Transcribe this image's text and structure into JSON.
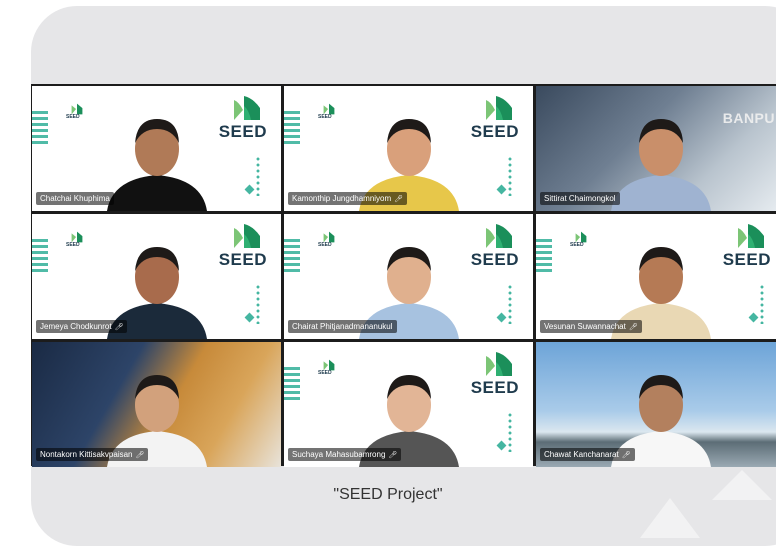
{
  "caption": "\"SEED Project\"",
  "logo_text": "SEED",
  "banner_text": "BANPU",
  "participants": [
    {
      "name": "Chatchai Khuphima",
      "bg": "seed",
      "muted": false
    },
    {
      "name": "Kamonthip Jungdhamniyom",
      "bg": "seed",
      "muted": true
    },
    {
      "name": "Sittirat Chaimongkol",
      "bg": "office",
      "muted": false
    },
    {
      "name": "Jemeya Chodkunrot",
      "bg": "seed",
      "muted": true
    },
    {
      "name": "Chairat Phitjanadmananukul",
      "bg": "seed",
      "muted": false
    },
    {
      "name": "Vesunan Suwannachat",
      "bg": "seed",
      "muted": true
    },
    {
      "name": "Nontakorn Kittisakvpaisan",
      "bg": "lounge",
      "muted": true
    },
    {
      "name": "Suchaya Mahasubamrong",
      "bg": "seed",
      "muted": true
    },
    {
      "name": "Chawat Kanchanarat",
      "bg": "beach",
      "muted": true
    }
  ],
  "colors": {
    "accent": "#16a48a",
    "logo": "#1f3b4d",
    "card": "#e6e6e8"
  }
}
